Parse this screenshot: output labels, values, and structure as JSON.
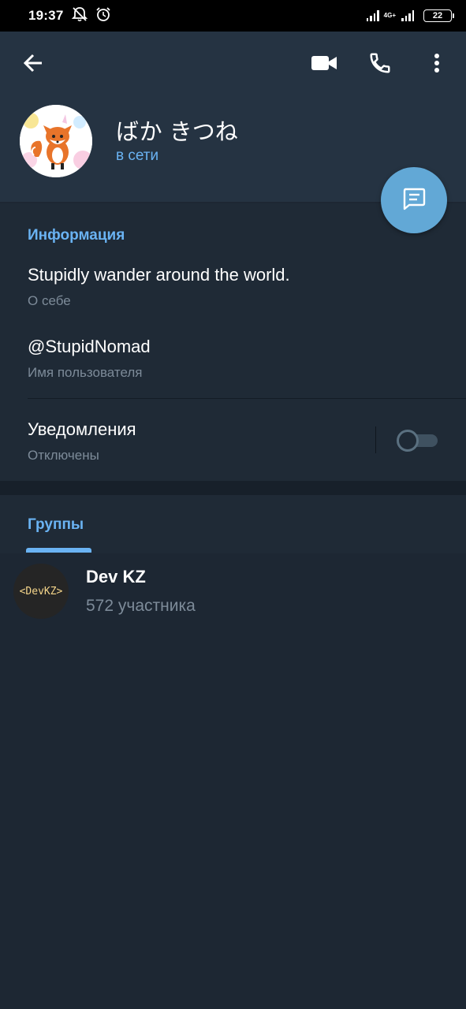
{
  "status_bar": {
    "time": "19:37",
    "network": "4G+",
    "battery": "22"
  },
  "toolbar": {
    "back_icon": "arrow-left-icon",
    "video_icon": "video-camera-icon",
    "call_icon": "phone-icon",
    "menu_icon": "more-vertical-icon"
  },
  "profile": {
    "name": "ばか きつね",
    "status": "в сети",
    "avatar": "fox-avatar"
  },
  "fab": {
    "icon": "message-icon"
  },
  "info": {
    "title": "Информация",
    "bio": "Stupidly wander around the world.",
    "bio_label": "О себе",
    "username": "@StupidNomad",
    "username_label": "Имя пользователя",
    "notifications": "Уведомления",
    "notifications_state": "Отключены",
    "notifications_enabled": false
  },
  "groups": {
    "title": "Группы",
    "items": [
      {
        "avatar_text": "<DevKZ>",
        "name": "Dev KZ",
        "members": "572 участника"
      }
    ]
  },
  "colors": {
    "accent": "#6ab3f3",
    "header_bg": "#253342",
    "section_bg": "#1f2a36",
    "page_bg": "#1d2733",
    "fab": "#62a8d6"
  }
}
